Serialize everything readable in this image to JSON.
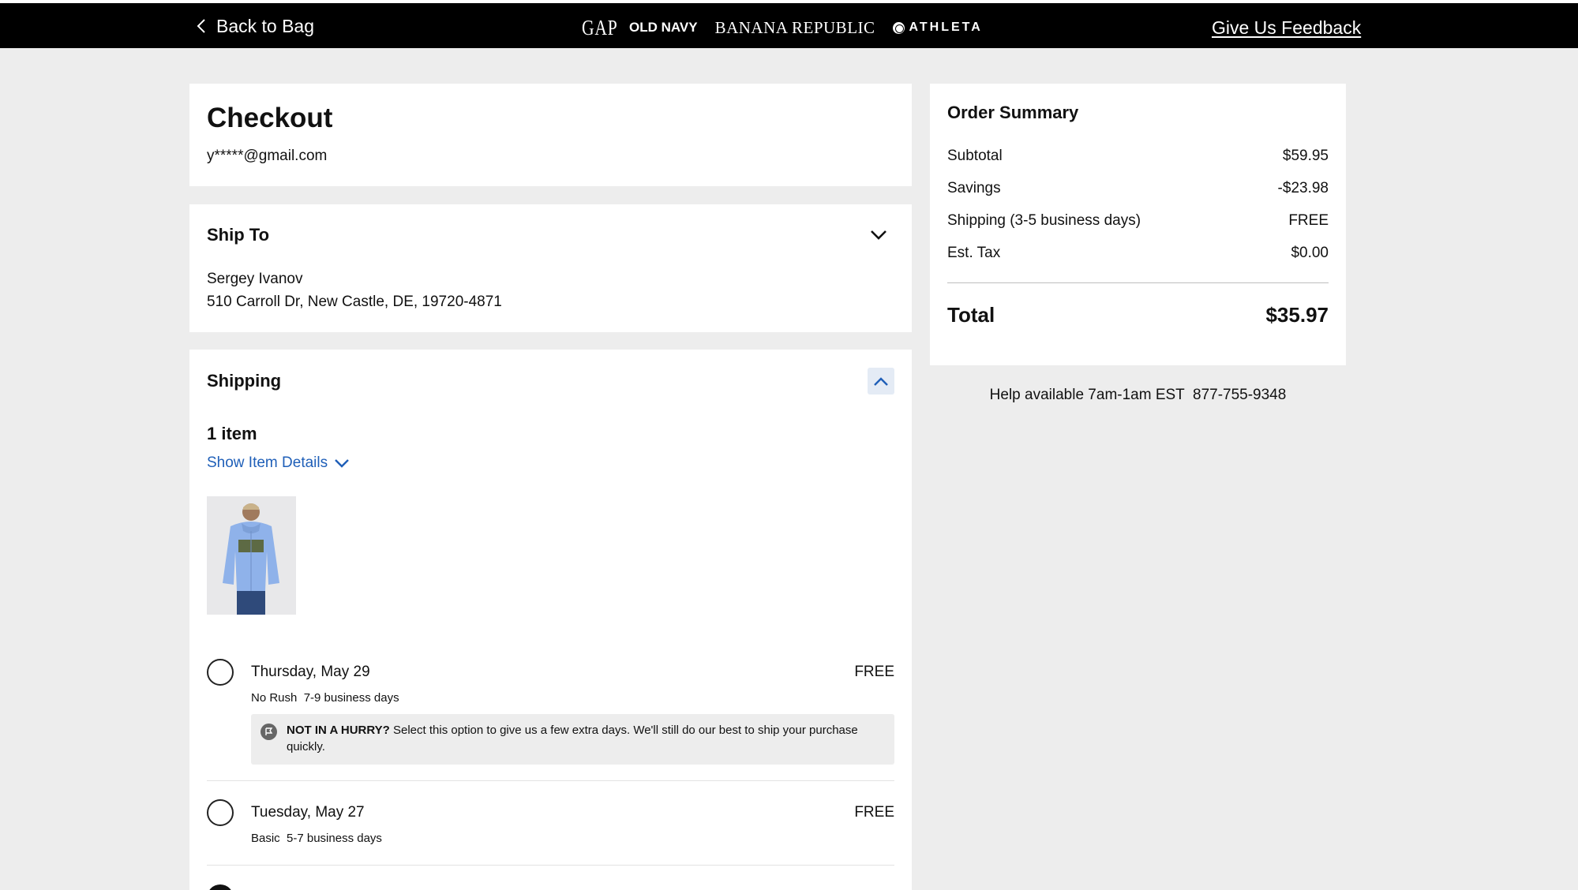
{
  "header": {
    "back_label": "Back to Bag",
    "brands": [
      "GAP",
      "OLD NAVY",
      "BANANA REPUBLIC",
      "ATHLETA"
    ],
    "feedback_label": "Give Us Feedback"
  },
  "checkout": {
    "title": "Checkout",
    "email": "y*****@gmail.com"
  },
  "ship_to": {
    "title": "Ship To",
    "name": "Sergey Ivanov",
    "address": "510 Carroll Dr, New Castle, DE, 19720-4871"
  },
  "shipping": {
    "title": "Shipping",
    "items_count": "1 item",
    "show_details_label": "Show Item Details",
    "options": [
      {
        "date": "Thursday, May 29",
        "price": "FREE",
        "subtitle": "No Rush  7-9 business days",
        "notice_bold": "NOT IN A HURRY?",
        "notice_text": " Select this option to give us a few extra days. We'll still do our best to ship your purchase quickly.",
        "selected": false
      },
      {
        "date": "Tuesday, May 27",
        "price": "FREE",
        "subtitle": "Basic  5-7 business days",
        "selected": false
      }
    ]
  },
  "summary": {
    "title": "Order Summary",
    "rows": [
      {
        "label": "Subtotal",
        "value": "$59.95"
      },
      {
        "label": "Savings",
        "value": "-$23.98"
      },
      {
        "label": "Shipping (3-5 business days)",
        "value": "FREE"
      },
      {
        "label": "Est. Tax",
        "value": "$0.00"
      }
    ],
    "total_label": "Total",
    "total_value": "$35.97",
    "help_text": "Help available 7am-1am EST  877-755-9348"
  },
  "colors": {
    "accent_link": "#1f5fb8",
    "header_bg": "#000000",
    "page_bg": "#ededed"
  }
}
